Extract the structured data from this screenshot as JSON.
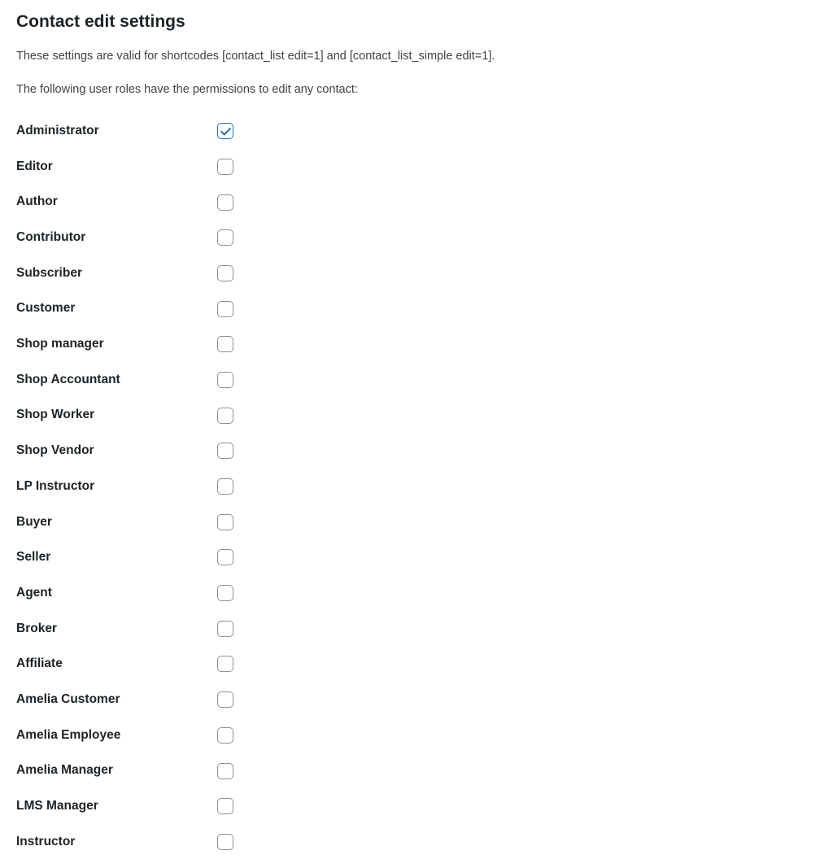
{
  "heading": "Contact edit settings",
  "description": "These settings are valid for shortcodes [contact_list edit=1] and [contact_list_simple edit=1].",
  "subdescription": "The following user roles have the permissions to edit any contact:",
  "roles": [
    {
      "label": "Administrator",
      "checked": true
    },
    {
      "label": "Editor",
      "checked": false
    },
    {
      "label": "Author",
      "checked": false
    },
    {
      "label": "Contributor",
      "checked": false
    },
    {
      "label": "Subscriber",
      "checked": false
    },
    {
      "label": "Customer",
      "checked": false
    },
    {
      "label": "Shop manager",
      "checked": false
    },
    {
      "label": "Shop Accountant",
      "checked": false
    },
    {
      "label": "Shop Worker",
      "checked": false
    },
    {
      "label": "Shop Vendor",
      "checked": false
    },
    {
      "label": "LP Instructor",
      "checked": false
    },
    {
      "label": "Buyer",
      "checked": false
    },
    {
      "label": "Seller",
      "checked": false
    },
    {
      "label": "Agent",
      "checked": false
    },
    {
      "label": "Broker",
      "checked": false
    },
    {
      "label": "Affiliate",
      "checked": false
    },
    {
      "label": "Amelia Customer",
      "checked": false
    },
    {
      "label": "Amelia Employee",
      "checked": false
    },
    {
      "label": "Amelia Manager",
      "checked": false
    },
    {
      "label": "LMS Manager",
      "checked": false
    },
    {
      "label": "Instructor",
      "checked": false
    }
  ]
}
